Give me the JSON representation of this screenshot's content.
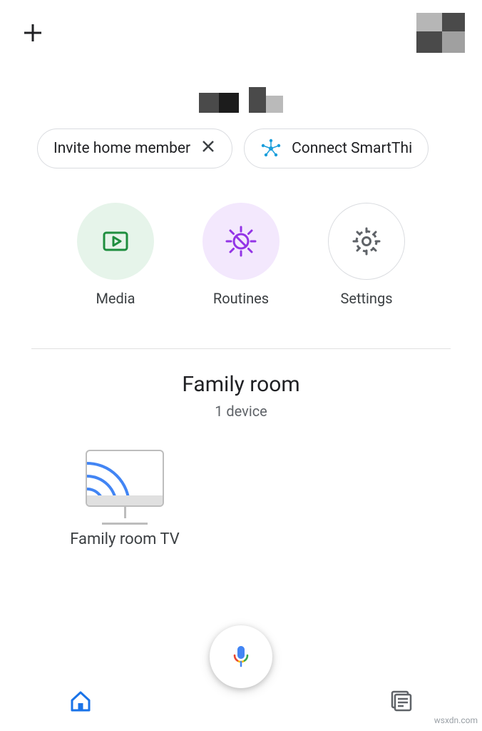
{
  "chips": [
    {
      "label": "Invite home member",
      "icon": "close"
    },
    {
      "label": "Connect SmartThi",
      "icon": "smartthings"
    }
  ],
  "quick_actions": {
    "media": {
      "label": "Media"
    },
    "routines": {
      "label": "Routines"
    },
    "settings": {
      "label": "Settings"
    }
  },
  "room": {
    "title": "Family room",
    "device_count": "1 device",
    "devices": [
      {
        "label": "Family room TV"
      }
    ]
  },
  "colors": {
    "media_bg": "#e6f4ea",
    "media_fg": "#1e8e3e",
    "routines_bg": "#f3e8fd",
    "routines_fg": "#9334e6",
    "settings_fg": "#5f6368",
    "accent": "#1a73e8"
  },
  "watermark": "wsxdn.com"
}
